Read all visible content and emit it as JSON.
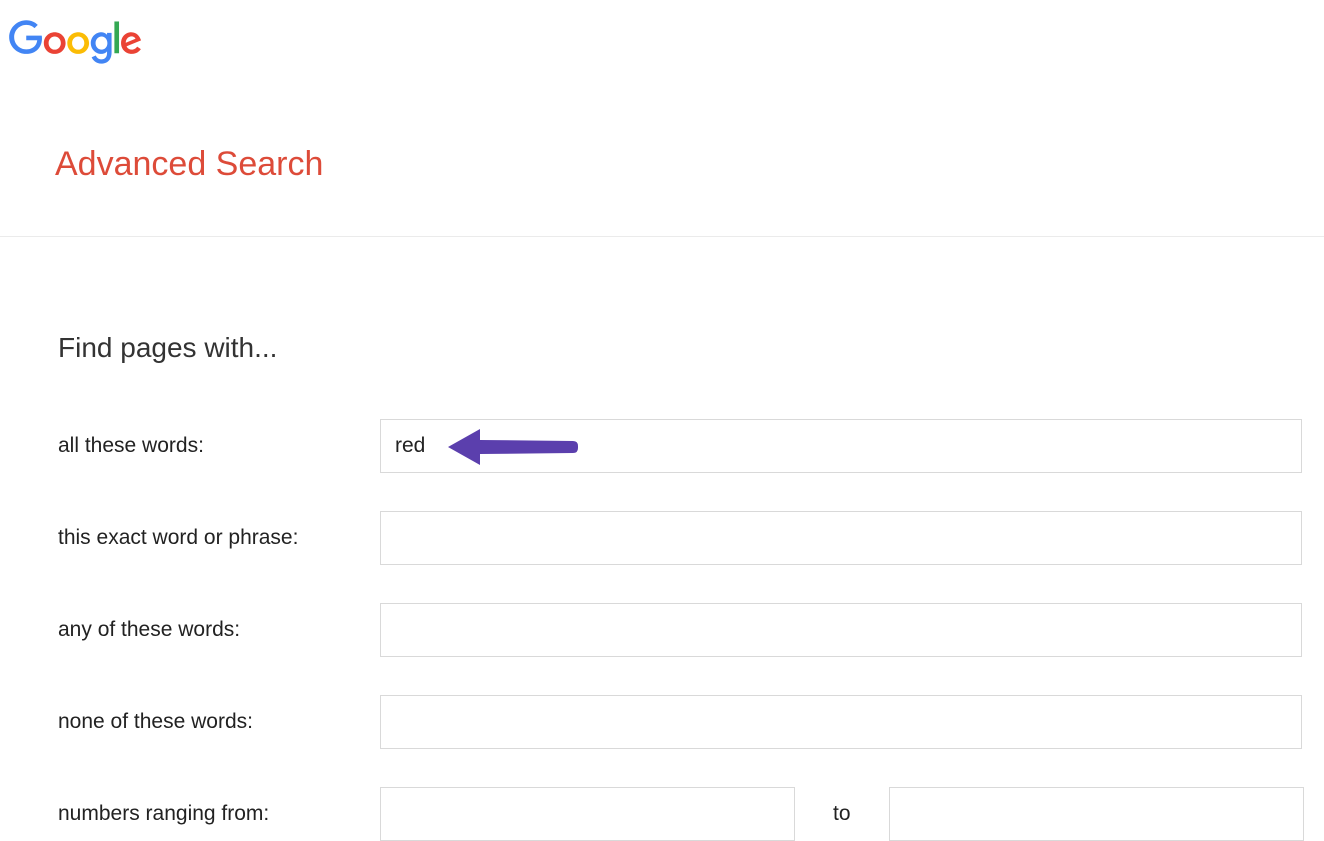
{
  "page_title": "Advanced Search",
  "section_heading": "Find pages with...",
  "fields": {
    "all_words": {
      "label": "all these words:",
      "value": "red"
    },
    "exact_phrase": {
      "label": "this exact word or phrase:",
      "value": ""
    },
    "any_words": {
      "label": "any of these words:",
      "value": ""
    },
    "none_words": {
      "label": "none of these words:",
      "value": ""
    },
    "range": {
      "label": "numbers ranging from:",
      "from_value": "",
      "to_value": "",
      "separator": "to"
    }
  },
  "annotation": {
    "arrow_color": "#5b3fad"
  }
}
